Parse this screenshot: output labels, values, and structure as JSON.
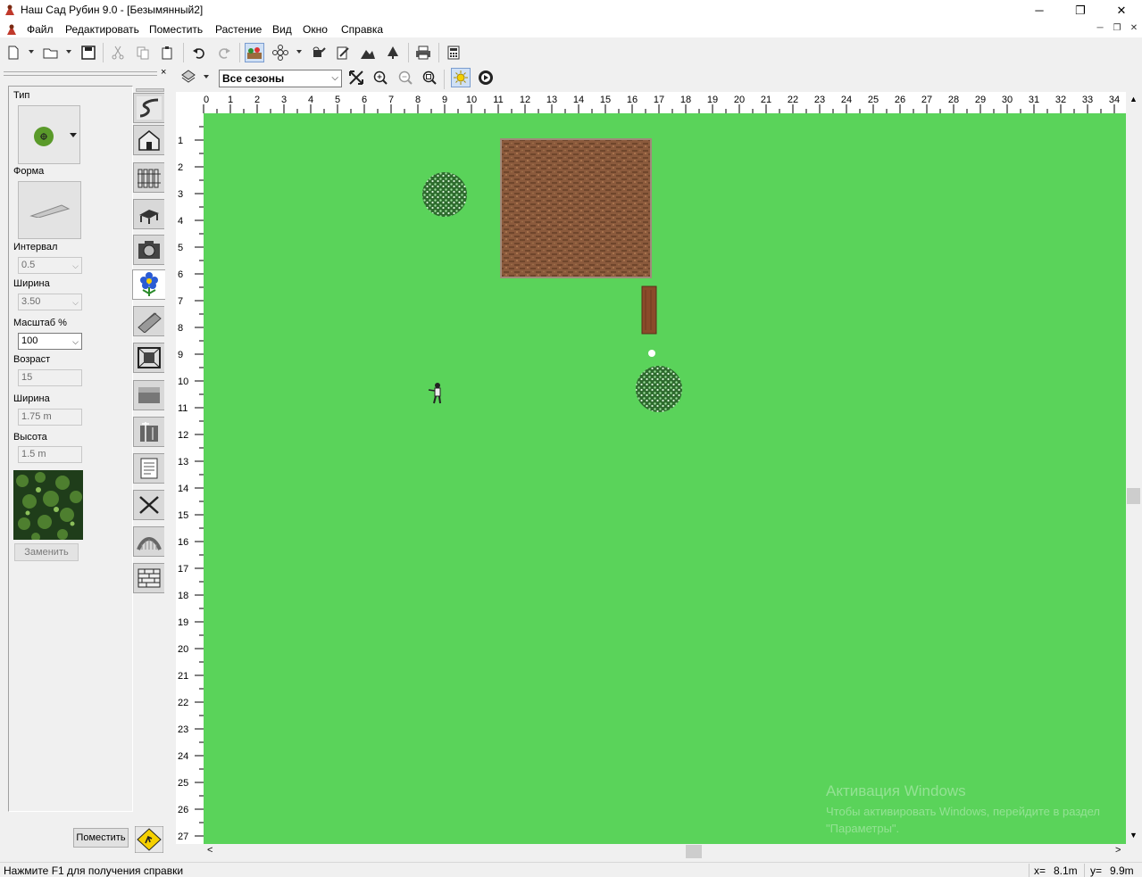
{
  "window": {
    "title": "Наш Сад Рубин 9.0 - [Безымянный2]",
    "minimize_glyph": "─",
    "maximize_glyph": "❐",
    "close_glyph": "✕"
  },
  "menu": {
    "items": [
      "Файл",
      "Редактировать",
      "Поместить",
      "Растение",
      "Вид",
      "Окно",
      "Справка"
    ]
  },
  "toolbar": {
    "icons": [
      "new-file-icon",
      "open-folder-icon",
      "save-icon",
      "cut-icon",
      "copy-icon",
      "paste-icon",
      "undo-icon",
      "redo-icon",
      "garden-bed-icon",
      "flower-settings-icon",
      "watering-can-icon",
      "notes-icon",
      "terrain-icon",
      "tree-icon",
      "print-icon",
      "calculator-icon"
    ]
  },
  "left_panel": {
    "close_glyph": "×",
    "type_label": "Тип",
    "shape_label": "Форма",
    "interval_label": "Интервал",
    "interval_value": "0.5",
    "width_label": "Ширина",
    "width_value": "3.50",
    "scale_label": "Масштаб %",
    "scale_value": "100",
    "age_label": "Возраст",
    "age_value": "15",
    "width2_label": "Ширина",
    "width2_value": "1.75 m",
    "height_label": "Высота",
    "height_value": "1.5 m",
    "replace_label": "Заменить",
    "place_label": "Поместить"
  },
  "tool_tabs": [
    "path-tab-icon",
    "house-tab-icon",
    "fence-tab-icon",
    "bench-tab-icon",
    "camera-tab-icon",
    "flower-tab-icon",
    "log-tab-icon",
    "frame-tab-icon",
    "texture-tab-icon",
    "dimension-tab-icon",
    "text-tab-icon",
    "tools-tab-icon",
    "bridge-tab-icon",
    "wall-tab-icon"
  ],
  "view_toolbar": {
    "season": "Все сезоны"
  },
  "ruler": {
    "top_labels": [
      "0",
      "1",
      "2",
      "3",
      "4",
      "5",
      "6",
      "7",
      "8",
      "9",
      "10",
      "11",
      "12",
      "13",
      "14",
      "15",
      "16",
      "17",
      "18",
      "19",
      "20",
      "21",
      "22",
      "23",
      "24",
      "25",
      "26",
      "27",
      "28",
      "29",
      "30",
      "31",
      "32",
      "33",
      "34"
    ],
    "left_labels": [
      "1",
      "2",
      "3",
      "4",
      "5",
      "6",
      "7",
      "8",
      "9",
      "10",
      "11",
      "12",
      "13",
      "14",
      "15",
      "16",
      "17",
      "18",
      "19",
      "20",
      "21",
      "22",
      "23",
      "24",
      "25",
      "26",
      "27"
    ]
  },
  "status": {
    "help": "Нажмите F1 для получения справки",
    "x_label": "x=",
    "x_value": "8.1m",
    "y_label": "y=",
    "y_value": "9.9m"
  },
  "watermark": {
    "title": "Активация Windows",
    "body": "Чтобы активировать Windows, перейдите в раздел \"Параметры\"."
  },
  "colors": {
    "lawn": "#5ad35a",
    "soil": "#8b5a3c",
    "trunk": "#8a4a2a"
  }
}
